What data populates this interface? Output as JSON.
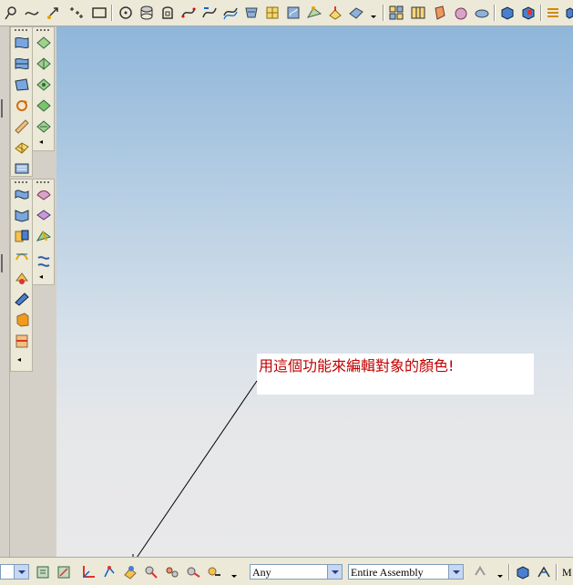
{
  "toolbar": {
    "top_icons": [
      "lasso-icon",
      "spline-icon",
      "point-icon",
      "point-set-icon",
      "rectangle-icon",
      "circle-icon",
      "cylinder-icon",
      "loop-icon",
      "curve-icon",
      "curve-edit-icon",
      "curve-offset-icon",
      "surface-icon",
      "surface-edit-icon",
      "patch-icon",
      "sweep-icon",
      "drape-icon",
      "shade-icon",
      "layout-icon",
      "grid-icon",
      "shell-icon",
      "sphere-icon",
      "solid-icon",
      "cube-icon",
      "cube-alt-icon",
      "layer-icon",
      "more-icon"
    ]
  },
  "palette_left": {
    "icons_a": [
      "surface-tool-icon",
      "surface-tool-2-icon",
      "surface-tool-3-icon",
      "rotate-surface-icon",
      "ruler-surface-icon",
      "mesh-icon",
      "sheet-icon"
    ],
    "icons_b": [
      "wave-surface-icon",
      "fold-surface-icon",
      "cube-split-icon",
      "curve-surface-icon",
      "fill-surface-icon",
      "shade-surface-icon",
      "box-color-icon",
      "door-icon"
    ]
  },
  "palette_right": {
    "icons_a": [
      "green-surface-icon",
      "green-surface-2-icon",
      "green-surface-3-icon",
      "green-surface-4-icon",
      "green-surface-5-icon"
    ],
    "icons_b": [
      "pink-surface-icon",
      "pink-surface-2-icon",
      "blend-surface-icon",
      "transform-icon"
    ]
  },
  "callout": {
    "text": "用這個功能來編輯對象的顏色!"
  },
  "bottom": {
    "filter_value": "Any",
    "scope_value": "Entire Assembly",
    "trailing_text": "M"
  },
  "colors": {
    "callout_text": "#c00000",
    "viewport_top": "#8fb6d9",
    "viewport_bottom": "#e9e9ea"
  }
}
